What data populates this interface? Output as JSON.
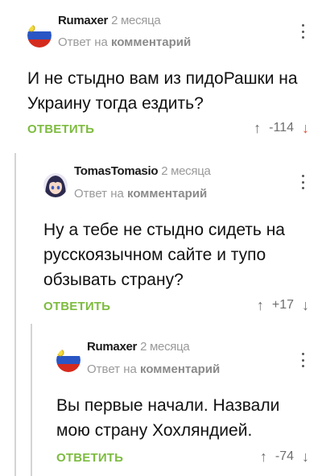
{
  "comments": [
    {
      "author": "Rumaxer",
      "age": "2 месяца",
      "reply_prefix": "Ответ на",
      "reply_link": "комментарий",
      "text": "И не стыдно вам из пидоРашки на Украину тогда ездить?",
      "reply_label": "ОТВЕТИТЬ",
      "rating": "-114",
      "avatar": "russia-flag"
    },
    {
      "author": "TomasTomasio",
      "age": "2 месяца",
      "reply_prefix": "Ответ на",
      "reply_link": "комментарий",
      "text": "Ну а тебе не стыдно сидеть на русскоязычном сайте и тупо обзывать страну?",
      "reply_label": "ОТВЕТИТЬ",
      "rating": "+17",
      "avatar": "anime-avatar"
    },
    {
      "author": "Rumaxer",
      "age": "2 месяца",
      "reply_prefix": "Ответ на",
      "reply_link": "комментарий",
      "text": "Вы первые начали. Назвали мою страну Хохляндией.",
      "reply_label": "ОТВЕТИТЬ",
      "rating": "-74",
      "avatar": "russia-flag"
    }
  ],
  "colors": {
    "reply": "#7dbb3f",
    "downvote": "#e0533d",
    "muted": "#9a9a9a",
    "thread": "#d4d4d4"
  },
  "icons": {
    "upvote": "↑",
    "downvote": "↓"
  }
}
